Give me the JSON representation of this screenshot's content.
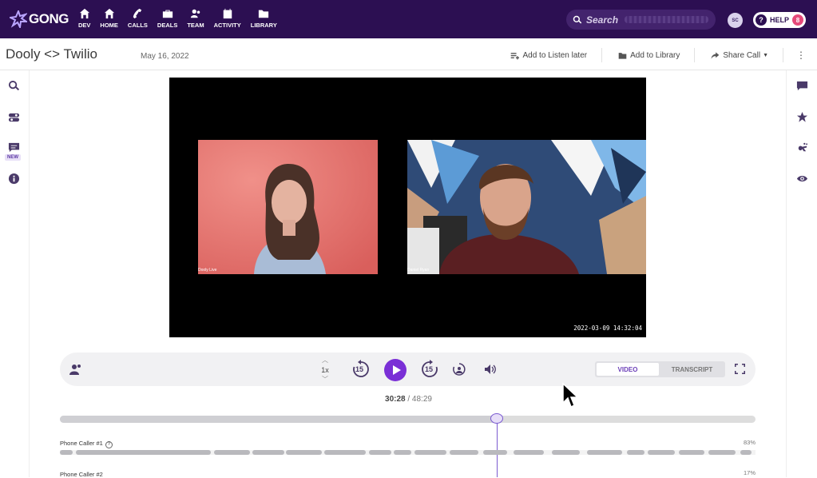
{
  "nav": {
    "logo_text": "GONG",
    "items": [
      {
        "label": "DEV",
        "icon": "home-icon"
      },
      {
        "label": "HOME",
        "icon": "home-icon"
      },
      {
        "label": "CALLS",
        "icon": "phone-icon"
      },
      {
        "label": "DEALS",
        "icon": "briefcase-icon"
      },
      {
        "label": "TEAM",
        "icon": "team-icon"
      },
      {
        "label": "ACTIVITY",
        "icon": "calendar-icon"
      },
      {
        "label": "LIBRARY",
        "icon": "folder-icon"
      }
    ],
    "search_placeholder": "Search",
    "avatar_initials": "SC",
    "help_label": "HELP",
    "help_badge": "8"
  },
  "call": {
    "title": "Dooly <> Twilio",
    "date": "May 16, 2022",
    "actions": {
      "listen_later": "Add to Listen later",
      "add_library": "Add to Library",
      "share_call": "Share Call"
    }
  },
  "left_rail": {
    "new_tag": "NEW"
  },
  "video": {
    "left_name": "Dooly Live",
    "right_name": "Daniel Ryan",
    "timestamp": "2022-03-09 14:32:04"
  },
  "player": {
    "speed": "1x",
    "skip_back": "15",
    "skip_forward": "15",
    "video_tab": "VIDEO",
    "transcript_tab": "TRANSCRIPT",
    "current_time": "30:28",
    "duration": "/ 48:29",
    "progress_fraction": 0.628
  },
  "speakers": [
    {
      "name": "Phone Caller #1",
      "percent": "83%"
    },
    {
      "name": "Phone Caller #2",
      "percent": "17%"
    }
  ],
  "colors": {
    "nav_bg": "#2c0f52",
    "accent": "#7a2fd6",
    "badge": "#e5497a"
  }
}
